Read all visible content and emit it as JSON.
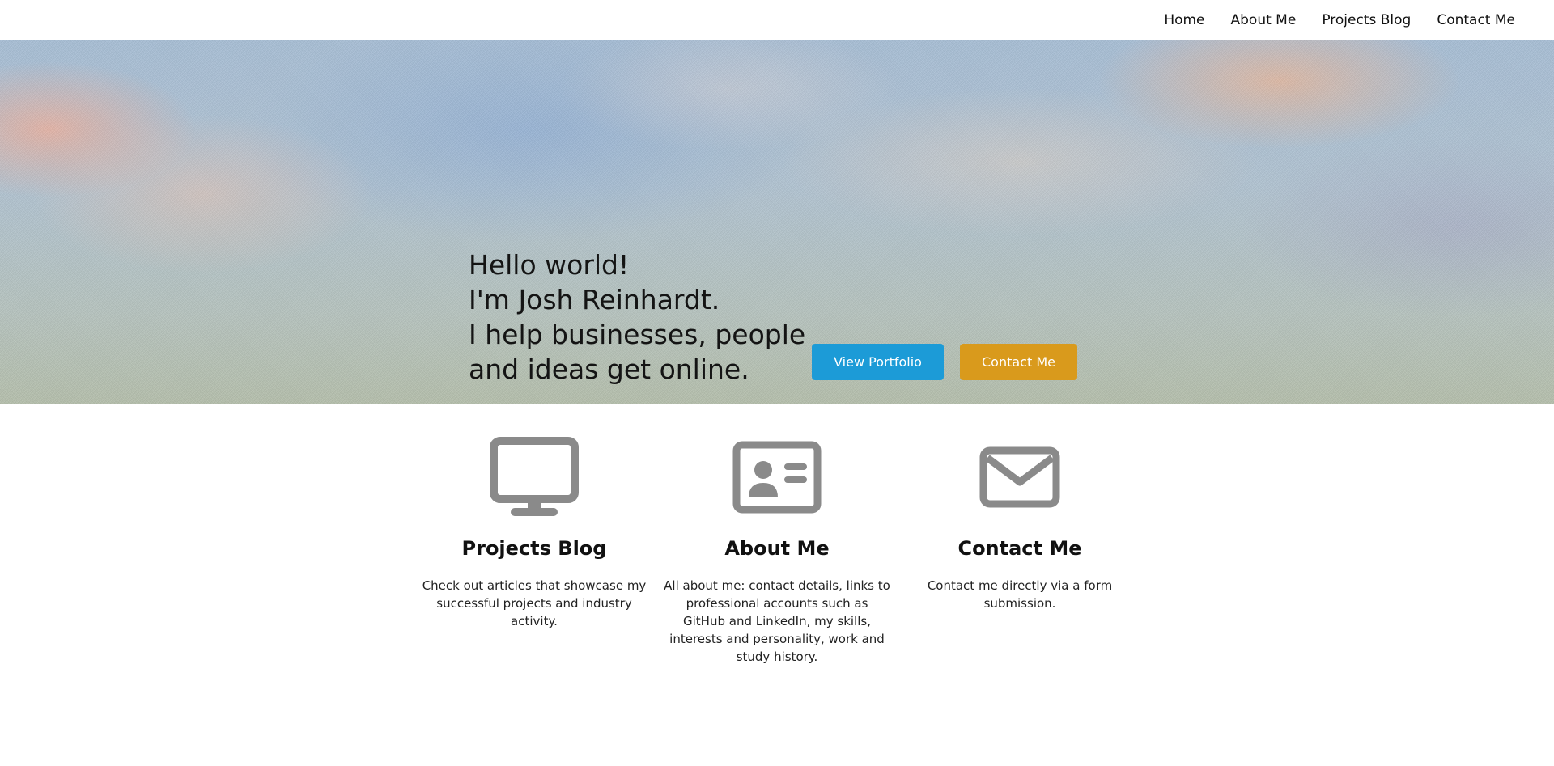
{
  "nav": {
    "items": [
      {
        "label": "Home"
      },
      {
        "label": "About Me"
      },
      {
        "label": "Projects Blog"
      },
      {
        "label": "Contact Me"
      }
    ]
  },
  "hero": {
    "lines": [
      "Hello world!",
      "I'm Josh Reinhardt.",
      "I help businesses, people",
      "and ideas get online."
    ],
    "buttons": {
      "portfolio": "View Portfolio",
      "contact": "Contact Me"
    }
  },
  "features": [
    {
      "icon": "monitor-icon",
      "title": "Projects Blog",
      "description": "Check out articles that showcase my successful projects and industry activity."
    },
    {
      "icon": "id-card-icon",
      "title": "About Me",
      "description": "All about me: contact details, links to professional accounts such as GitHub and LinkedIn, my skills, interests and personality, work and study history."
    },
    {
      "icon": "envelope-icon",
      "title": "Contact Me",
      "description": "Contact me directly via a form submission."
    }
  ],
  "colors": {
    "portfolio_button": "#1c9bd7",
    "contact_button": "#d99a1c",
    "icon_gray": "#8a8a8a"
  }
}
